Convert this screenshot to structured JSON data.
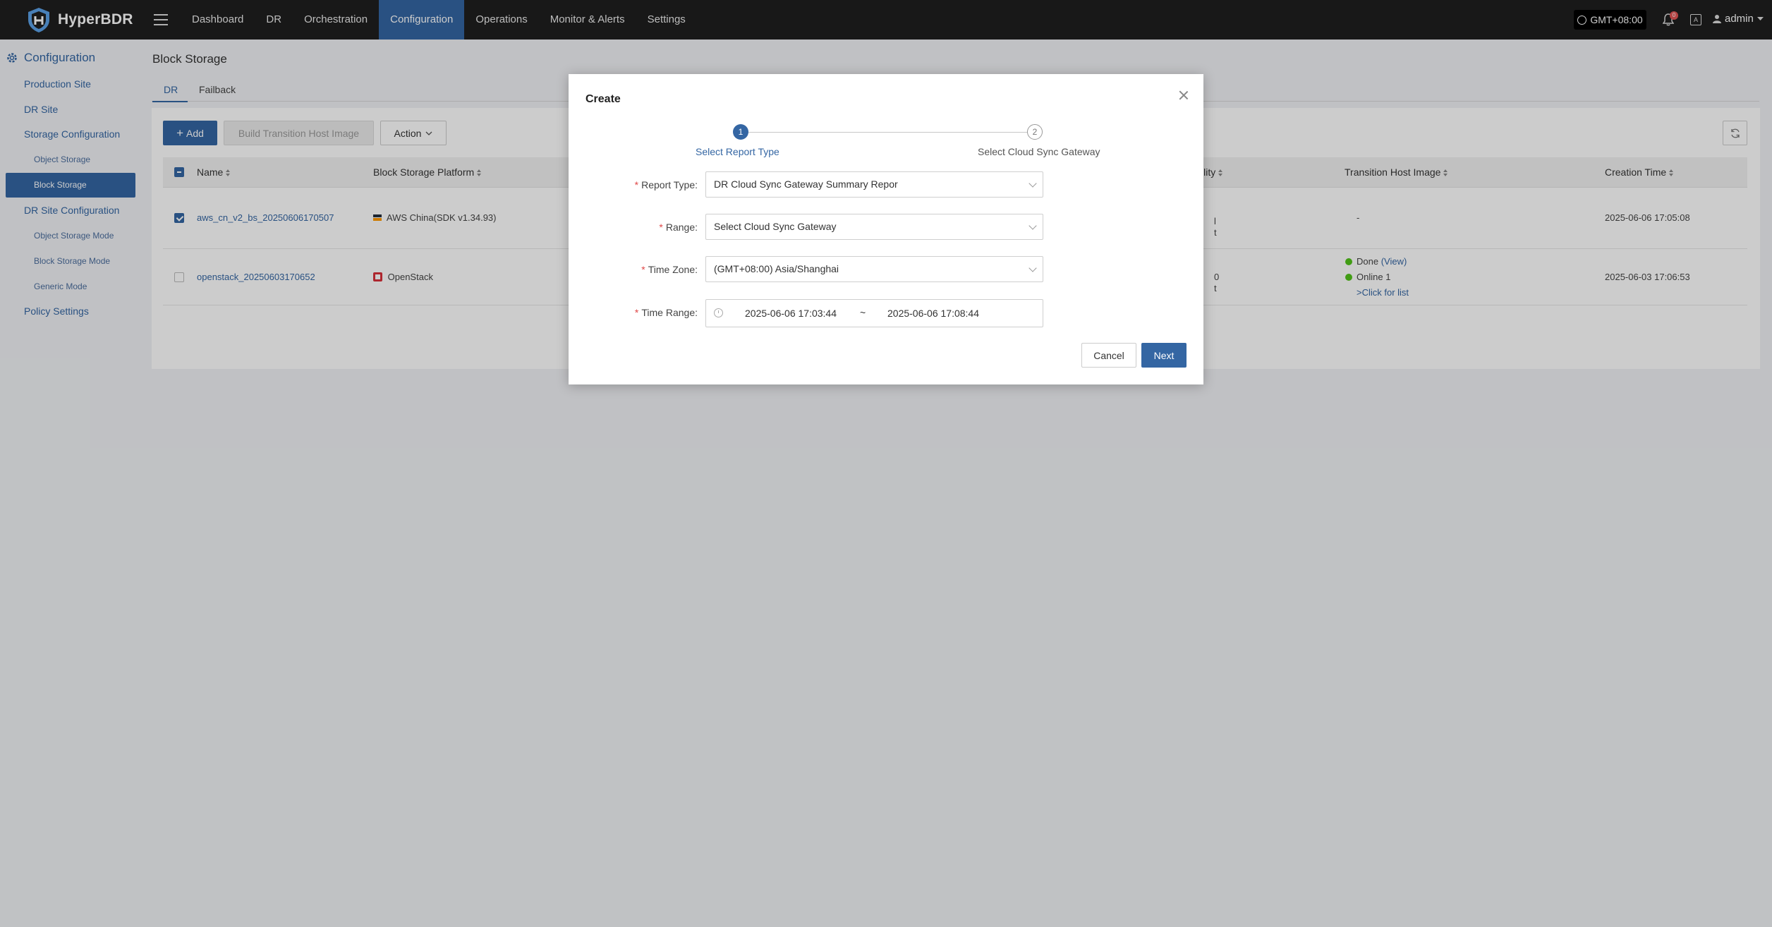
{
  "app": {
    "name": "HyperBDR"
  },
  "nav": {
    "items": [
      "Dashboard",
      "DR",
      "Orchestration",
      "Configuration",
      "Operations",
      "Monitor & Alerts",
      "Settings"
    ],
    "active": "Configuration"
  },
  "header": {
    "timezone": "GMT+08:00",
    "notification_count": "0",
    "lang_icon": "A",
    "user": "admin"
  },
  "sidebar": {
    "title": "Configuration",
    "items": [
      {
        "label": "Production Site"
      },
      {
        "label": "DR Site"
      },
      {
        "label": "Storage Configuration"
      },
      {
        "label": "Object Storage"
      },
      {
        "label": "Block Storage"
      },
      {
        "label": "DR Site Configuration"
      },
      {
        "label": "Object Storage Mode"
      },
      {
        "label": "Block Storage Mode"
      },
      {
        "label": "Generic Mode"
      },
      {
        "label": "Policy Settings"
      }
    ]
  },
  "page": {
    "title": "Block Storage",
    "tabs": [
      "DR",
      "Failback"
    ],
    "toolbar": {
      "add": "Add",
      "build": "Build Transition Host Image",
      "action": "Action"
    },
    "table": {
      "columns": [
        "Name",
        "Block Storage Platform",
        "ility",
        "Transition Host Image",
        "Creation Time"
      ],
      "rows": [
        {
          "name": "aws_cn_v2_bs_20250606170507",
          "platform": "AWS China(SDK v1.34.93)",
          "partial": [
            "l",
            "t"
          ],
          "image": "-",
          "created": "2025-06-06 17:05:08",
          "checked": true
        },
        {
          "name": "openstack_20250603170652",
          "platform": "OpenStack",
          "partial": [
            "0",
            "t"
          ],
          "image_status": "Done",
          "image_view": "(View)",
          "image_online": "Online 1",
          "image_list": ">Click for list",
          "created": "2025-06-03 17:06:53",
          "checked": false
        }
      ]
    }
  },
  "modal": {
    "title": "Create",
    "steps": [
      {
        "num": "1",
        "label": "Select Report Type",
        "active": true
      },
      {
        "num": "2",
        "label": "Select Cloud Sync Gateway",
        "active": false
      }
    ],
    "fields": {
      "report_type": {
        "label": "Report Type:",
        "value": "DR Cloud Sync Gateway Summary Repor"
      },
      "range": {
        "label": "Range:",
        "value": "Select Cloud Sync Gateway"
      },
      "time_zone": {
        "label": "Time Zone:",
        "value": "(GMT+08:00) Asia/Shanghai"
      },
      "time_range": {
        "label": "Time Range:",
        "start": "2025-06-06 17:03:44",
        "separator": "~",
        "end": "2025-06-06 17:08:44"
      }
    },
    "buttons": {
      "cancel": "Cancel",
      "next": "Next"
    }
  },
  "colors": {
    "primary": "#3466a3",
    "topbar": "#1e1e1e",
    "success": "#52c41a",
    "required": "#e04848"
  }
}
